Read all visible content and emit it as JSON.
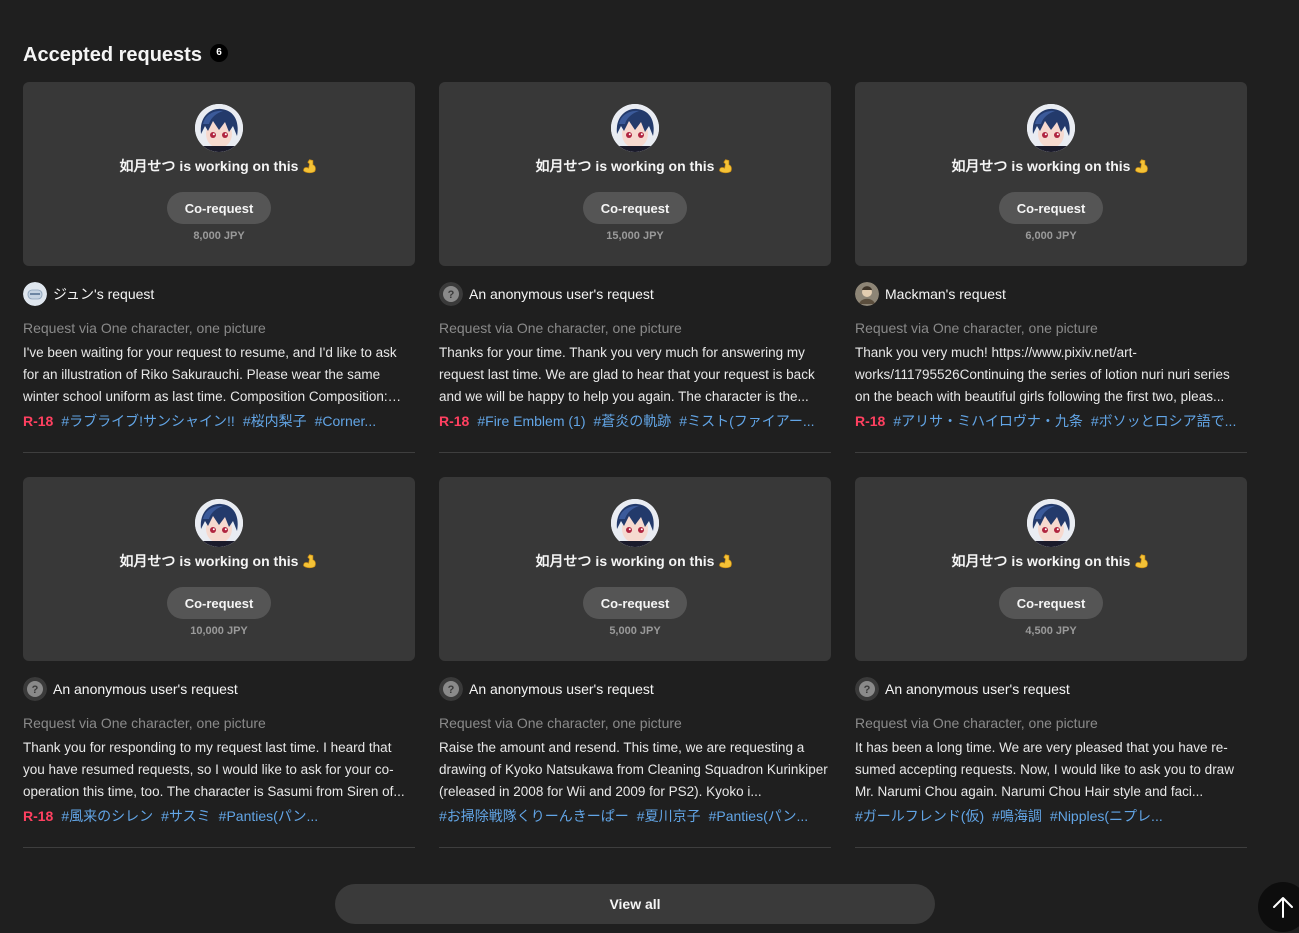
{
  "section": {
    "title": "Accepted requests",
    "count": "6"
  },
  "creator": {
    "working_text": "如月せつ is working on this",
    "button_label": "Co-request"
  },
  "requests": [
    {
      "price": "8,000 JPY",
      "requester": "ジュン's request",
      "requester_avatar": "robot-avatar",
      "via": "Request via One character, one picture",
      "text": "I've been waiting for your request to resume, and I'd like to ask for an illustration of Riko Sakurauchi. Please wear the same winter school uniform as last time. Composition Composition: Corner...",
      "rating": "R-18",
      "tags": [
        "#ラブライブ!サンシャイン!!",
        "#桜内梨子",
        "#Corner..."
      ]
    },
    {
      "price": "15,000 JPY",
      "requester": "An anonymous user's request",
      "requester_avatar": "anonymous",
      "via": "Request via One character, one picture",
      "text": "Thanks for your time. Thank you very much for answering my request last time. We are glad to hear that your request is back and we will be happy to help you again. The character is the...",
      "rating": "R-18",
      "tags": [
        "#Fire Emblem (1)",
        "#蒼炎の軌跡",
        "#ミスト(ファイアー..."
      ]
    },
    {
      "price": "6,000 JPY",
      "requester": "Mackman's request",
      "requester_avatar": "photo-avatar",
      "via": "Request via One character, one picture",
      "text": "Thank you very much! https://www.pixiv.net/art-works/111795526Continuing the series of lotion nuri nuri series on the beach with beautiful girls following the first two, pleas...",
      "rating": "R-18",
      "tags": [
        "#アリサ・ミハイロヴナ・九条",
        "#ボソッとロシア語で..."
      ]
    },
    {
      "price": "10,000 JPY",
      "requester": "An anonymous user's request",
      "requester_avatar": "anonymous",
      "via": "Request via One character, one picture",
      "text": "Thank you for responding to my request last time. I heard that you have resumed requests, so I would like to ask for your co-operation this time, too. The character is Sasumi from Siren of...",
      "rating": "R-18",
      "tags": [
        "#風来のシレン",
        "#サスミ",
        "#Panties(パン..."
      ]
    },
    {
      "price": "5,000 JPY",
      "requester": "An anonymous user's request",
      "requester_avatar": "anonymous",
      "via": "Request via One character, one picture",
      "text": "Raise the amount and resend. This time, we are requesting a drawing of Kyoko Natsukawa from Cleaning Squadron Kurinkiper (released in 2008 for Wii and 2009 for PS2). Kyoko i...",
      "rating": "",
      "tags": [
        "#お掃除戦隊くりーんきーぱー",
        "#夏川京子",
        "#Panties(パン..."
      ]
    },
    {
      "price": "4,500 JPY",
      "requester": "An anonymous user's request",
      "requester_avatar": "anonymous",
      "via": "Request via One character, one picture",
      "text": "It has been a long time. We are very pleased that you have re-sumed accepting requests. Now, I would like to ask you to draw Mr. Narumi Chou again. Narumi Chou Hair style and faci...",
      "rating": "",
      "tags": [
        "#ガールフレンド(仮)",
        "#鳴海調",
        "#Nipples(ニプレ..."
      ]
    }
  ],
  "footer": {
    "view_all_label": "View all"
  },
  "colors": {
    "background": "#1f1f1f",
    "panel": "#383838",
    "tag": "#62a5e6",
    "r18": "#ff4060"
  },
  "icons": {
    "working_emoji": "flexed-biceps-icon",
    "scroll_top": "arrow-up-icon"
  }
}
